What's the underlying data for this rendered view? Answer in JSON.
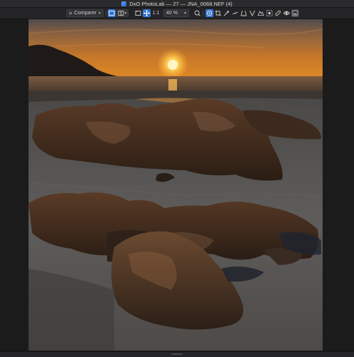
{
  "window": {
    "title": "DxO PhotoLab — 27 — JNA_0068.NEF (4)"
  },
  "toolbar": {
    "compare_label": "Comparer",
    "one_to_one_label": "1:1",
    "zoom_value": "40 %"
  },
  "colors": {
    "accent": "#2f6fcf",
    "background": "#1f1f21",
    "toolbar": "#242426"
  }
}
